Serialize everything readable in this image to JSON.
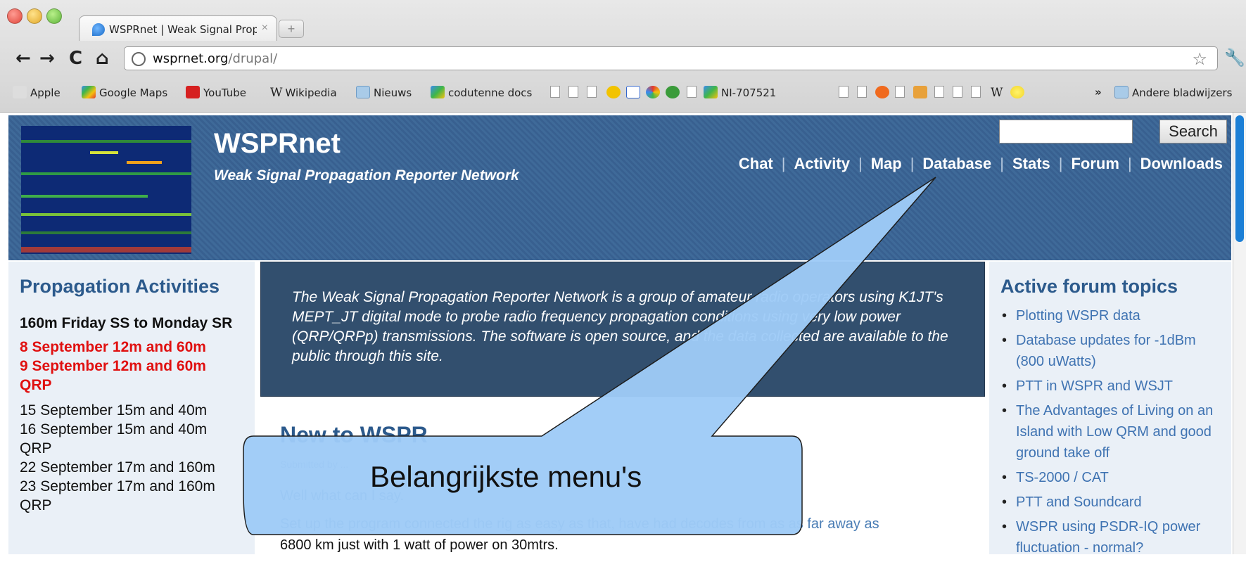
{
  "browser": {
    "tab_title": "WSPRnet | Weak Signal Propa",
    "tab_close": "×",
    "new_tab": "+",
    "url_host": "wsprnet.org",
    "url_path": "/drupal/",
    "back": "←",
    "forward": "→",
    "reload": "C",
    "home": "⌂",
    "star": "☆",
    "wrench": "🔧"
  },
  "bookmarks": {
    "apple": "Apple",
    "google_maps": "Google Maps",
    "youtube": "YouTube",
    "wikipedia": "Wikipedia",
    "nieuws": "Nieuws",
    "codutenne": "codutenne docs",
    "ni": "NI-707521",
    "more": "»",
    "andere": "Andere bladwijzers"
  },
  "header": {
    "title": "WSPRnet",
    "slogan": "Weak Signal Propagation Reporter Network",
    "search_button": "Search",
    "nav": [
      "Chat",
      "Activity",
      "Map",
      "Database",
      "Stats",
      "Forum",
      "Downloads"
    ]
  },
  "left": {
    "title": "Propagation Activities",
    "lines": [
      {
        "text": "160m Friday SS to Monday SR",
        "style": "bold"
      },
      {
        "text": "8 September 12m and 60m",
        "style": "red"
      },
      {
        "text": "9 September 12m and 60m",
        "style": "red"
      },
      {
        "text": "QRP",
        "style": "red"
      },
      {
        "text": "15 September 15m and 40m",
        "style": "normal"
      },
      {
        "text": "16 September 15m and 40m",
        "style": "normal"
      },
      {
        "text": "QRP",
        "style": "normal"
      },
      {
        "text": "22 September 17m and 160m",
        "style": "normal"
      },
      {
        "text": "23 September 17m and 160m",
        "style": "normal"
      },
      {
        "text": "QRP",
        "style": "normal"
      }
    ]
  },
  "center": {
    "mission": "The Weak Signal Propagation Reporter Network is a group of amateur radio operators using K1JT's MEPT_JT digital mode to probe radio frequency propagation conditions using very low power (QRP/QRPp) transmissions. The software is open source, and the data collected are available to the public through this site.",
    "node_title": "New to WSPR",
    "submitted": "Submitted by ...",
    "line1": "Well what can I say.",
    "line2": "Set up the program connected the rig as easy as that, have had decodes from as as far away as",
    "line3": "6800 km just with 1 watt of power on 30mtrs."
  },
  "right": {
    "title": "Active forum topics",
    "topics": [
      "Plotting WSPR data",
      "Database updates for -1dBm (800 uWatts)",
      "PTT in WSPR and WSJT",
      "The Advantages of Living on an Island with Low QRM and good ground take off",
      "TS-2000 / CAT",
      "PTT and Soundcard",
      "WSPR using PSDR-IQ power fluctuation - normal?"
    ]
  },
  "callout": {
    "text": "Belangrijkste menu's",
    "color": "#9ecbf7"
  }
}
